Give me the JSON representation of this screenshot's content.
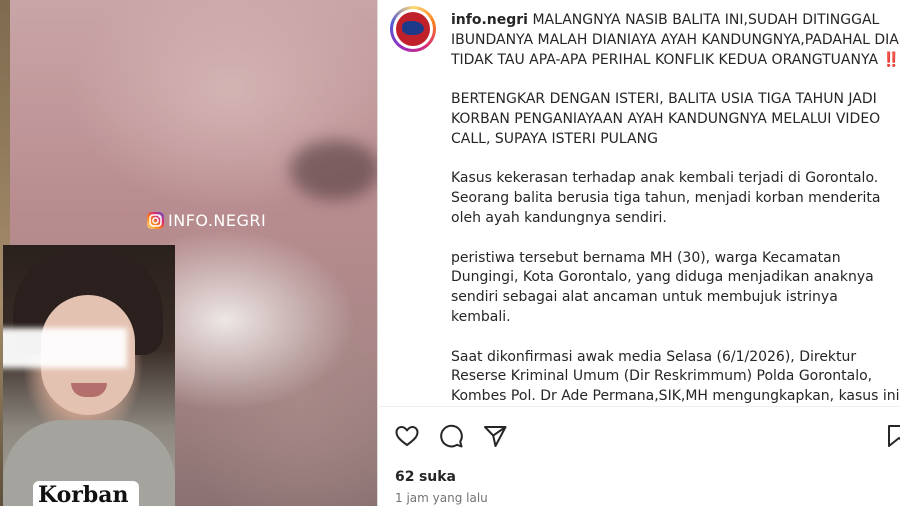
{
  "post": {
    "media": {
      "watermark": "INFO.NEGRI",
      "inset_label": "Korban"
    },
    "author": {
      "username": "info.negri"
    },
    "caption": {
      "headline": "MALANGNYA NASIB BALITA INI,SUDAH DITINGGAL IBUNDANYA MALAH DIANIAYA AYAH KANDUNGNYA,PADAHAL DIA TIDAK TAU APA-APA PERIHAL KONFLIK KEDUA ORANGTUANYA ‼️",
      "paragraphs": [
        "BERTENGKAR DENGAN ISTERI, BALITA USIA TIGA TAHUN JADI KORBAN PENGANIAYAAN AYAH KANDUNGNYA MELALUI VIDEO CALL, SUPAYA ISTERI PULANG",
        "Kasus kekerasan terhadap anak kembali terjadi di Gorontalo. Seorang balita berusia tiga tahun, menjadi korban menderita oleh ayah kandungnya sendiri.",
        "peristiwa tersebut bernama MH (30), warga Kecamatan Dungingi, Kota Gorontalo, yang diduga menjadikan anaknya sendiri sebagai alat ancaman untuk membujuk istrinya kembali.",
        "Saat dikonfirmasi awak media Selasa (6/1/2026), Direktur Reserse Kriminal Umum (Dir Reskrimmum) Polda Gorontalo, Kombes Pol. Dr Ade Permana,SIK,MH mengungkapkan, kasus ini sudah"
      ]
    },
    "actions": {
      "icons": [
        "heart-icon",
        "comment-icon",
        "share-icon",
        "bookmark-icon"
      ]
    },
    "likes": {
      "count": "62",
      "label": "suka"
    },
    "timestamp": "1 jam yang lalu"
  },
  "colors": {
    "text": "#262626",
    "muted": "#737373",
    "divider": "#efefef"
  }
}
